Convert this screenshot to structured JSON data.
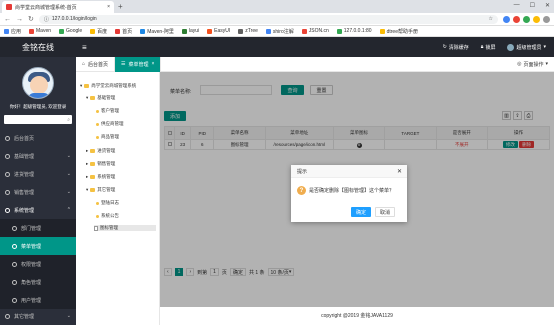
{
  "browser": {
    "tab_title": "尚学堂云商城管理系统-首页",
    "url": "127.0.0.1/login/login",
    "bookmarks": [
      "应用",
      "Maven",
      "Google",
      "百度",
      "首页",
      "Maven-阿里",
      "layui",
      "EasyUI",
      "zTree",
      "shiro注解",
      "JSON.cn",
      "127.0.0.1:80",
      "dtree帮助手册"
    ]
  },
  "header": {
    "brand": "金铭在线",
    "clear_cache": "清除缓存",
    "lock": "锁屏",
    "user": "超级管理员"
  },
  "sidebar": {
    "greeting": "你好！超级管理员, 欢迎登录",
    "items": [
      {
        "label": "后台首页"
      },
      {
        "label": "基础管理"
      },
      {
        "label": "进货管理"
      },
      {
        "label": "销售管理"
      },
      {
        "label": "系统管理"
      },
      {
        "label": "部门管理"
      },
      {
        "label": "菜单管理"
      },
      {
        "label": "权限管理"
      },
      {
        "label": "角色管理"
      },
      {
        "label": "用户管理"
      },
      {
        "label": "其它管理"
      }
    ]
  },
  "page_tabs": {
    "home": "后台首页",
    "current": "菜单管理",
    "page_ops": "页面操作"
  },
  "tree": {
    "root": "尚学堂云商城管理系统",
    "nodes": [
      "基础管理",
      "客户管理",
      "供应商管理",
      "商品管理",
      "进货管理",
      "销售管理",
      "系统管理",
      "其它管理",
      "登陆日志",
      "系统公告",
      "图标管理"
    ]
  },
  "search": {
    "label": "菜单名称:",
    "query_btn": "查询",
    "reset_btn": "重置"
  },
  "toolbar": {
    "add_btn": "添加"
  },
  "table": {
    "headers": [
      "ID",
      "PID",
      "菜单名称",
      "菜单地址",
      "菜单图标",
      "TARGET",
      "是否展开",
      "操作"
    ],
    "row": {
      "id": "23",
      "pid": "6",
      "name": "图标管理",
      "href": "/resources/page/icon.html",
      "target": "",
      "open": "不展开",
      "edit": "修改",
      "del": "删除"
    }
  },
  "pager": {
    "current": "1",
    "goto_prefix": "到第",
    "goto_value": "1",
    "goto_suffix": "页",
    "confirm": "确定",
    "total": "共 1 条",
    "per_page": "10 条/页"
  },
  "footer": "copyright @2019 金铭JAVA1129",
  "dialog": {
    "title": "提示",
    "message": "是否确定删除【图标管理】这个菜单？",
    "ok": "确定",
    "cancel": "取消"
  },
  "colors": {
    "teal": "#009688",
    "blue": "#1e9fff",
    "sidebar": "#2b2f3a",
    "header": "#23262e"
  }
}
